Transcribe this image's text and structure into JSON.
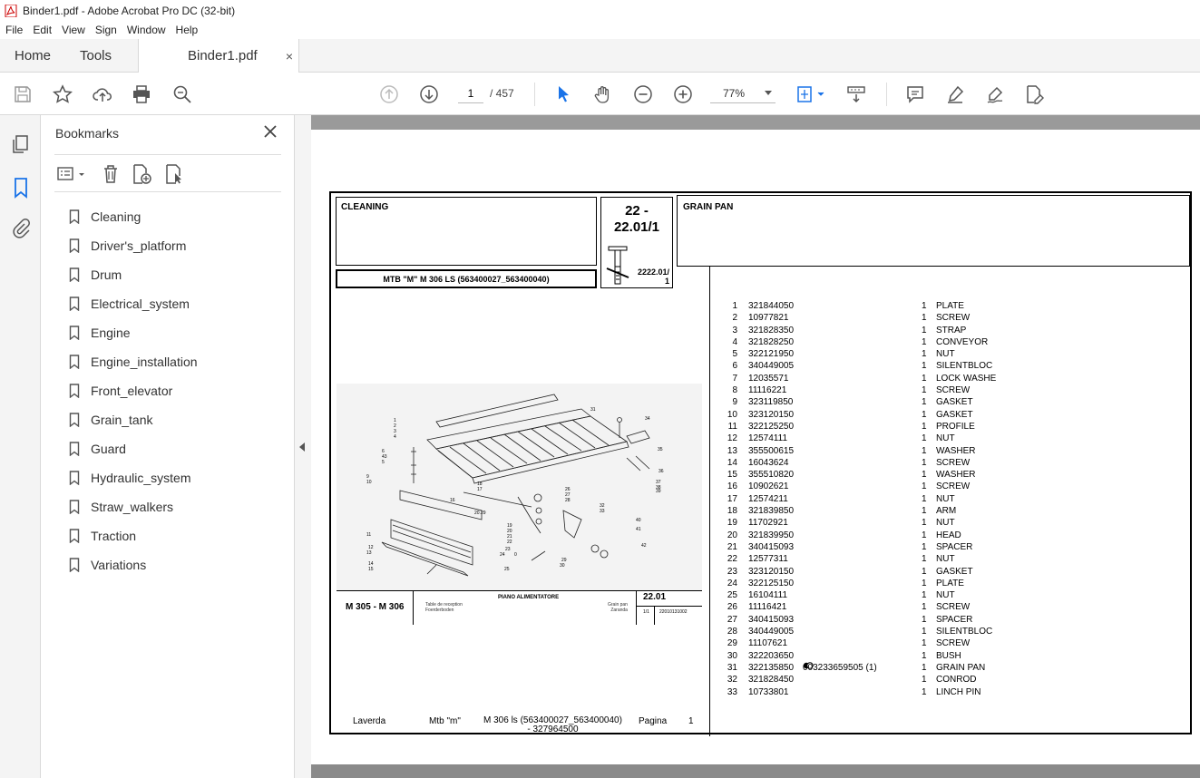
{
  "window": {
    "title": "Binder1.pdf - Adobe Acrobat Pro DC (32-bit)"
  },
  "menu": [
    "File",
    "Edit",
    "View",
    "Sign",
    "Window",
    "Help"
  ],
  "tabs": {
    "home": "Home",
    "tools": "Tools",
    "document": "Binder1.pdf",
    "close": "×"
  },
  "toolbar": {
    "page_current": "1",
    "page_total": "/ 457",
    "zoom": "77%"
  },
  "bookmarks": {
    "title": "Bookmarks",
    "items": [
      "Cleaning",
      "Driver's_platform",
      "Drum",
      "Electrical_system",
      "Engine",
      "Engine_installation",
      "Front_elevator",
      "Grain_tank",
      "Guard",
      "Hydraulic_system",
      "Straw_walkers",
      "Traction",
      "Variations"
    ]
  },
  "pdf": {
    "section": "CLEANING",
    "model_line": "MTB \"M\" M 306 LS (563400027_563400040)",
    "code_big": "22 - 22.01/1",
    "code_big_line1": "22 -",
    "code_big_line2": "22.01/1",
    "code_small_line1": "2222.01/",
    "code_small_line2": "1",
    "group": "GRAIN PAN",
    "diagram_footer": {
      "model": "M 305 - M 306",
      "title": "PIANO ALIMENTATORE",
      "lang1": "Table de reception",
      "lang2": "Foerderboden",
      "lang3": "Grain pan",
      "lang4": "Zaranda",
      "code": "22.01",
      "frac": "1/1",
      "number": "22010131002"
    },
    "footer": {
      "brand": "Laverda",
      "series": "Mtb \"m\"",
      "model_line1": "M 306 ls (563400027_563400040)",
      "model_line2": "- 327964500",
      "page_label": "Pagina",
      "page_num": "1"
    },
    "parts": [
      {
        "n": "1",
        "code": "321844050",
        "q": "1",
        "desc": "PLATE"
      },
      {
        "n": "2",
        "code": "10977821",
        "q": "1",
        "desc": "SCREW"
      },
      {
        "n": "3",
        "code": "321828350",
        "q": "1",
        "desc": "STRAP"
      },
      {
        "n": "4",
        "code": "321828250",
        "q": "1",
        "desc": "CONVEYOR"
      },
      {
        "n": "5",
        "code": "322121950",
        "q": "1",
        "desc": "NUT"
      },
      {
        "n": "6",
        "code": "340449005",
        "q": "1",
        "desc": "SILENTBLOC"
      },
      {
        "n": "7",
        "code": "12035571",
        "q": "1",
        "desc": "LOCK WASHE"
      },
      {
        "n": "8",
        "code": "11116221",
        "q": "1",
        "desc": "SCREW"
      },
      {
        "n": "9",
        "code": "323119850",
        "q": "1",
        "desc": "GASKET"
      },
      {
        "n": "10",
        "code": "323120150",
        "q": "1",
        "desc": "GASKET"
      },
      {
        "n": "11",
        "code": "322125250",
        "q": "1",
        "desc": "PROFILE"
      },
      {
        "n": "12",
        "code": "12574111",
        "q": "1",
        "desc": "NUT"
      },
      {
        "n": "13",
        "code": "355500615",
        "q": "1",
        "desc": "WASHER"
      },
      {
        "n": "14",
        "code": "16043624",
        "q": "1",
        "desc": "SCREW"
      },
      {
        "n": "15",
        "code": "355510820",
        "q": "1",
        "desc": "WASHER"
      },
      {
        "n": "16",
        "code": "10902621",
        "q": "1",
        "desc": "SCREW"
      },
      {
        "n": "17",
        "code": "12574211",
        "q": "1",
        "desc": "NUT"
      },
      {
        "n": "18",
        "code": "321839850",
        "q": "1",
        "desc": "ARM"
      },
      {
        "n": "19",
        "code": "11702921",
        "q": "1",
        "desc": "NUT"
      },
      {
        "n": "20",
        "code": "321839950",
        "q": "1",
        "desc": "HEAD"
      },
      {
        "n": "21",
        "code": "340415093",
        "q": "1",
        "desc": "SPACER"
      },
      {
        "n": "22",
        "code": "12577311",
        "q": "1",
        "desc": "NUT"
      },
      {
        "n": "23",
        "code": "323120150",
        "q": "1",
        "desc": "GASKET"
      },
      {
        "n": "24",
        "code": "322125150",
        "q": "1",
        "desc": "PLATE"
      },
      {
        "n": "25",
        "code": "16104111",
        "q": "1",
        "desc": "NUT"
      },
      {
        "n": "26",
        "code": "11116421",
        "q": "1",
        "desc": "SCREW"
      },
      {
        "n": "27",
        "code": "340415093",
        "q": "1",
        "desc": "SPACER"
      },
      {
        "n": "28",
        "code": "340449005",
        "q": "1",
        "desc": "SILENTBLOC"
      },
      {
        "n": "29",
        "code": "11107621",
        "q": "1",
        "desc": "SCREW"
      },
      {
        "n": "30",
        "code": "322203650",
        "q": "1",
        "desc": "BUSH"
      },
      {
        "n": "31",
        "code": "322135850",
        "q": "1",
        "desc": "GRAIN PAN",
        "extra": "003233659505  (1)"
      },
      {
        "n": "32",
        "code": "321828450",
        "q": "1",
        "desc": "CONROD"
      },
      {
        "n": "33",
        "code": "10733801",
        "q": "1",
        "desc": "LINCH PIN"
      }
    ]
  }
}
